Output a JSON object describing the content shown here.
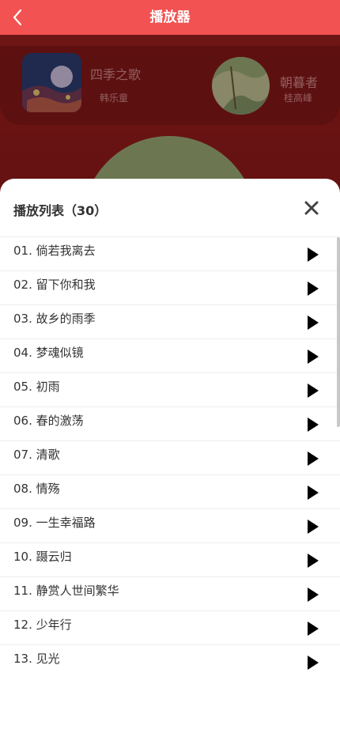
{
  "header": {
    "title": "播放器",
    "back_icon": "chevron-left-icon"
  },
  "now_playing": {
    "current": {
      "title": "四季之歌",
      "artist": "韩乐童"
    },
    "next": {
      "title": "朝暮者",
      "artist": "桂高峰"
    }
  },
  "playlist": {
    "title": "播放列表（30）",
    "close_icon": "close-icon",
    "play_icon": "play-icon",
    "items": [
      "01. 倘若我离去",
      "02. 留下你和我",
      "03. 故乡的雨季",
      "04. 梦魂似镜",
      "05. 初雨",
      "06. 春的激荡",
      "07. 清歌",
      "08. 情殇",
      "09. 一生幸福路",
      "10. 蹑云归",
      "11. 静赏人世间繁华",
      "12. 少年行",
      "13. 见光"
    ]
  },
  "colors": {
    "header_bg": "#f25252",
    "sheet_bg": "#ffffff",
    "text": "#333333"
  }
}
